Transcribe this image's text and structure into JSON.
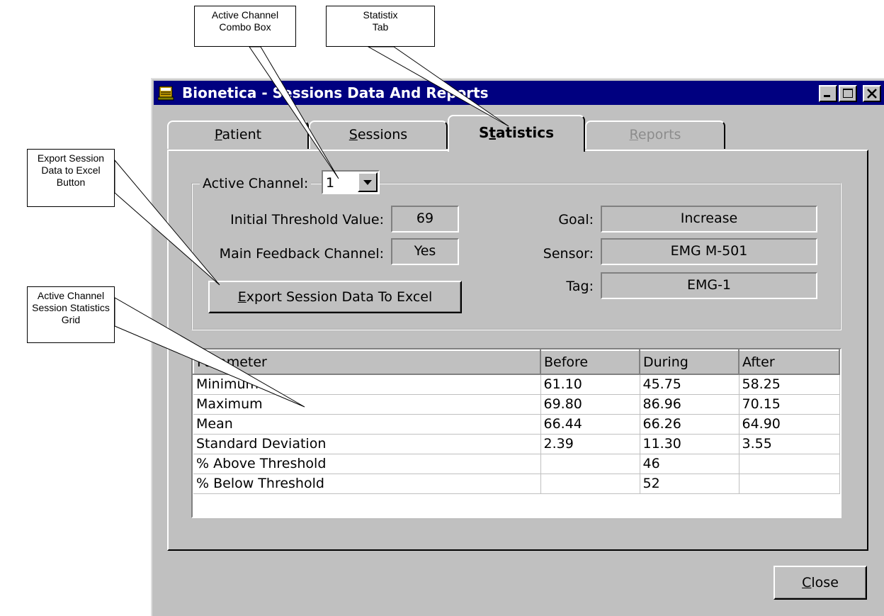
{
  "window": {
    "title": "Bionetica - Sessions Data And Reports"
  },
  "tabs": [
    {
      "pre": "",
      "ul": "P",
      "post": "atient"
    },
    {
      "pre": "",
      "ul": "S",
      "post": "essions"
    },
    {
      "pre": "S",
      "ul": "t",
      "post": "atistics"
    },
    {
      "pre": "",
      "ul": "R",
      "post": "eports"
    }
  ],
  "active_channel": {
    "label": "Active Channel:",
    "value": "1"
  },
  "fields": {
    "initial_threshold_label": "Initial Threshold Value:",
    "initial_threshold_value": "69",
    "main_feedback_label": "Main Feedback Channel:",
    "main_feedback_value": "Yes",
    "goal_label": "Goal:",
    "goal_value": "Increase",
    "sensor_label": "Sensor:",
    "sensor_value": "EMG M-501",
    "tag_label": "Tag:",
    "tag_value": "EMG-1"
  },
  "export_button": {
    "ul": "E",
    "post": "xport Session Data To Excel"
  },
  "grid": {
    "headers": [
      "Parameter",
      "Before",
      "During",
      "After"
    ],
    "rows": [
      [
        "Minimum",
        "61.10",
        "45.75",
        "58.25"
      ],
      [
        "Maximum",
        "69.80",
        "86.96",
        "70.15"
      ],
      [
        "Mean",
        "66.44",
        "66.26",
        "64.90"
      ],
      [
        "Standard Deviation",
        "2.39",
        "11.30",
        "3.55"
      ],
      [
        "% Above Threshold",
        "",
        "46",
        ""
      ],
      [
        "% Below Threshold",
        "",
        "52",
        ""
      ]
    ]
  },
  "close_button": {
    "ul": "C",
    "post": "lose"
  },
  "callouts": {
    "active_channel_combo": [
      "Active Channel",
      "Combo Box"
    ],
    "statistix_tab": [
      "Statistix",
      "Tab"
    ],
    "export_button": [
      "Export Session",
      "Data to Excel",
      "Button"
    ],
    "grid": [
      "Active Channel",
      "Session Statistics",
      "Grid"
    ]
  }
}
